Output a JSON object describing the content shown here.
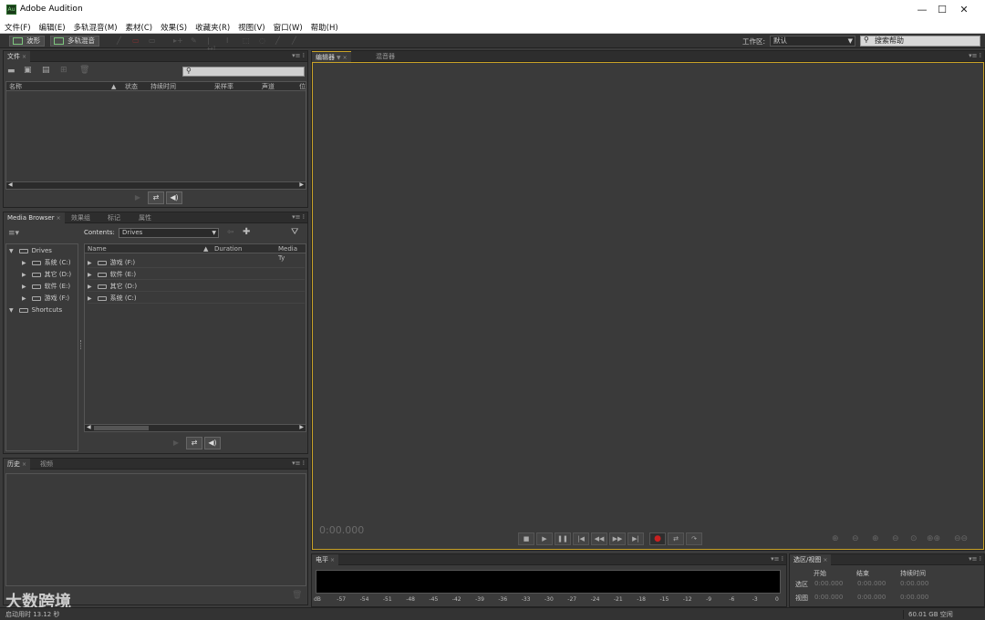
{
  "window": {
    "title": "Adobe Audition",
    "app_icon": "Au",
    "minimize": "—",
    "maximize": "☐",
    "close": "✕"
  },
  "menu": [
    "文件(F)",
    "编辑(E)",
    "多轨混音(M)",
    "素材(C)",
    "效果(S)",
    "收藏夹(R)",
    "视图(V)",
    "窗口(W)",
    "帮助(H)"
  ],
  "toolbar": {
    "waveform": "波形",
    "multitrack": "多轨混音",
    "workspace_label": "工作区:",
    "workspace_value": "默认",
    "help_search": "搜索帮助"
  },
  "files_panel": {
    "tab": "文件",
    "columns": [
      "名称",
      "状态",
      "持续时间",
      "采样率",
      "声道",
      "位"
    ]
  },
  "media_browser": {
    "tabs": [
      "Media Browser",
      "效果组",
      "标记",
      "属性"
    ],
    "contents_label": "Contents:",
    "contents_value": "Drives",
    "tree": {
      "drives_label": "Drives",
      "drives": [
        "系统 (C:)",
        "其它 (D:)",
        "软件 (E:)",
        "游戏 (F:)"
      ],
      "shortcuts_label": "Shortcuts"
    },
    "columns": [
      "Name",
      "Duration",
      "Media Ty"
    ],
    "items": [
      "游戏 (F:)",
      "软件 (E:)",
      "其它 (D:)",
      "系统 (C:)"
    ]
  },
  "history_panel": {
    "tabs": [
      "历史",
      "视频"
    ]
  },
  "editor": {
    "tabs": [
      "编辑器",
      "混音器"
    ],
    "timecode": "0:00.000"
  },
  "level_panel": {
    "tab": "电平",
    "ticks": [
      "dB",
      "-57",
      "-54",
      "-51",
      "-48",
      "-45",
      "-42",
      "-39",
      "-36",
      "-33",
      "-30",
      "-27",
      "-24",
      "-21",
      "-18",
      "-15",
      "-12",
      "-9",
      "-6",
      "-3",
      "0"
    ]
  },
  "selection_panel": {
    "tab": "选区/视图",
    "headers": [
      "开始",
      "结束",
      "持续时间"
    ],
    "rows": [
      {
        "label": "选区",
        "values": [
          "0:00.000",
          "0:00.000",
          "0:00.000"
        ]
      },
      {
        "label": "视图",
        "values": [
          "0:00.000",
          "0:00.000",
          "0:00.000"
        ]
      }
    ]
  },
  "status": {
    "launch": "启动用时 13.12 秒",
    "disk": "60.01 GB 空闲"
  },
  "watermark": "大数跨境",
  "colors": {
    "accent_border": "#c9a227",
    "record": "#c82020"
  }
}
